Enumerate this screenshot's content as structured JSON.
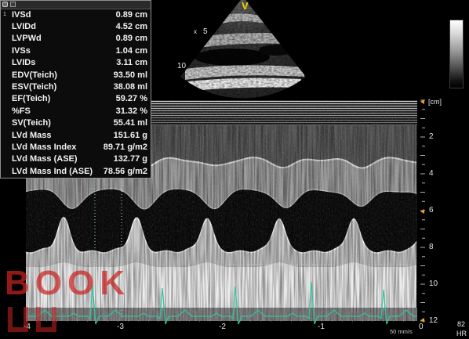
{
  "panel": {
    "icons": [
      "window-menu-icon",
      "panel-icon"
    ]
  },
  "measurements": {
    "index": "1",
    "rows": [
      {
        "label": "IVSd",
        "value": "0.89 cm"
      },
      {
        "label": "LVIDd",
        "value": "4.52 cm"
      },
      {
        "label": "LVPWd",
        "value": "0.89 cm"
      },
      {
        "label": "IVSs",
        "value": "1.04 cm"
      },
      {
        "label": "LVIDs",
        "value": "3.11 cm"
      },
      {
        "label": "EDV(Teich)",
        "value": "93.50 ml"
      },
      {
        "label": "ESV(Teich)",
        "value": "38.08 ml"
      },
      {
        "label": "EF(Teich)",
        "value": "59.27 %"
      },
      {
        "label": "%FS",
        "value": "31.32 %"
      },
      {
        "label": "SV(Teich)",
        "value": "55.41 ml"
      },
      {
        "label": "LVd Mass",
        "value": "151.61 g"
      },
      {
        "label": "LVd Mass Index",
        "value": "89.71 g/m2"
      },
      {
        "label": "LVd Mass (ASE)",
        "value": "132.77 g"
      },
      {
        "label": "LVd Mass Ind (ASE)",
        "value": "78.56 g/m2"
      }
    ]
  },
  "sector": {
    "mode_marker": "V",
    "focus_marker": "x",
    "depth_labels": [
      "5",
      "10"
    ]
  },
  "depth_scale": {
    "unit": "[cm]",
    "labels": [
      "2",
      "4",
      "6",
      "8",
      "10",
      "12"
    ]
  },
  "time_axis": {
    "labels": [
      "-4",
      "-3",
      "-2",
      "-1",
      "0"
    ]
  },
  "sweep_speed": "50 mm/s",
  "heart_rate": {
    "value": "82",
    "label": "HR"
  },
  "watermark": "BOOK",
  "colors": {
    "mode_marker": "#f2d200",
    "ecg": "#33c3a0",
    "scale_marker": "#f0a020",
    "watermark": "#cc2222",
    "text": "#f2f2f2"
  }
}
